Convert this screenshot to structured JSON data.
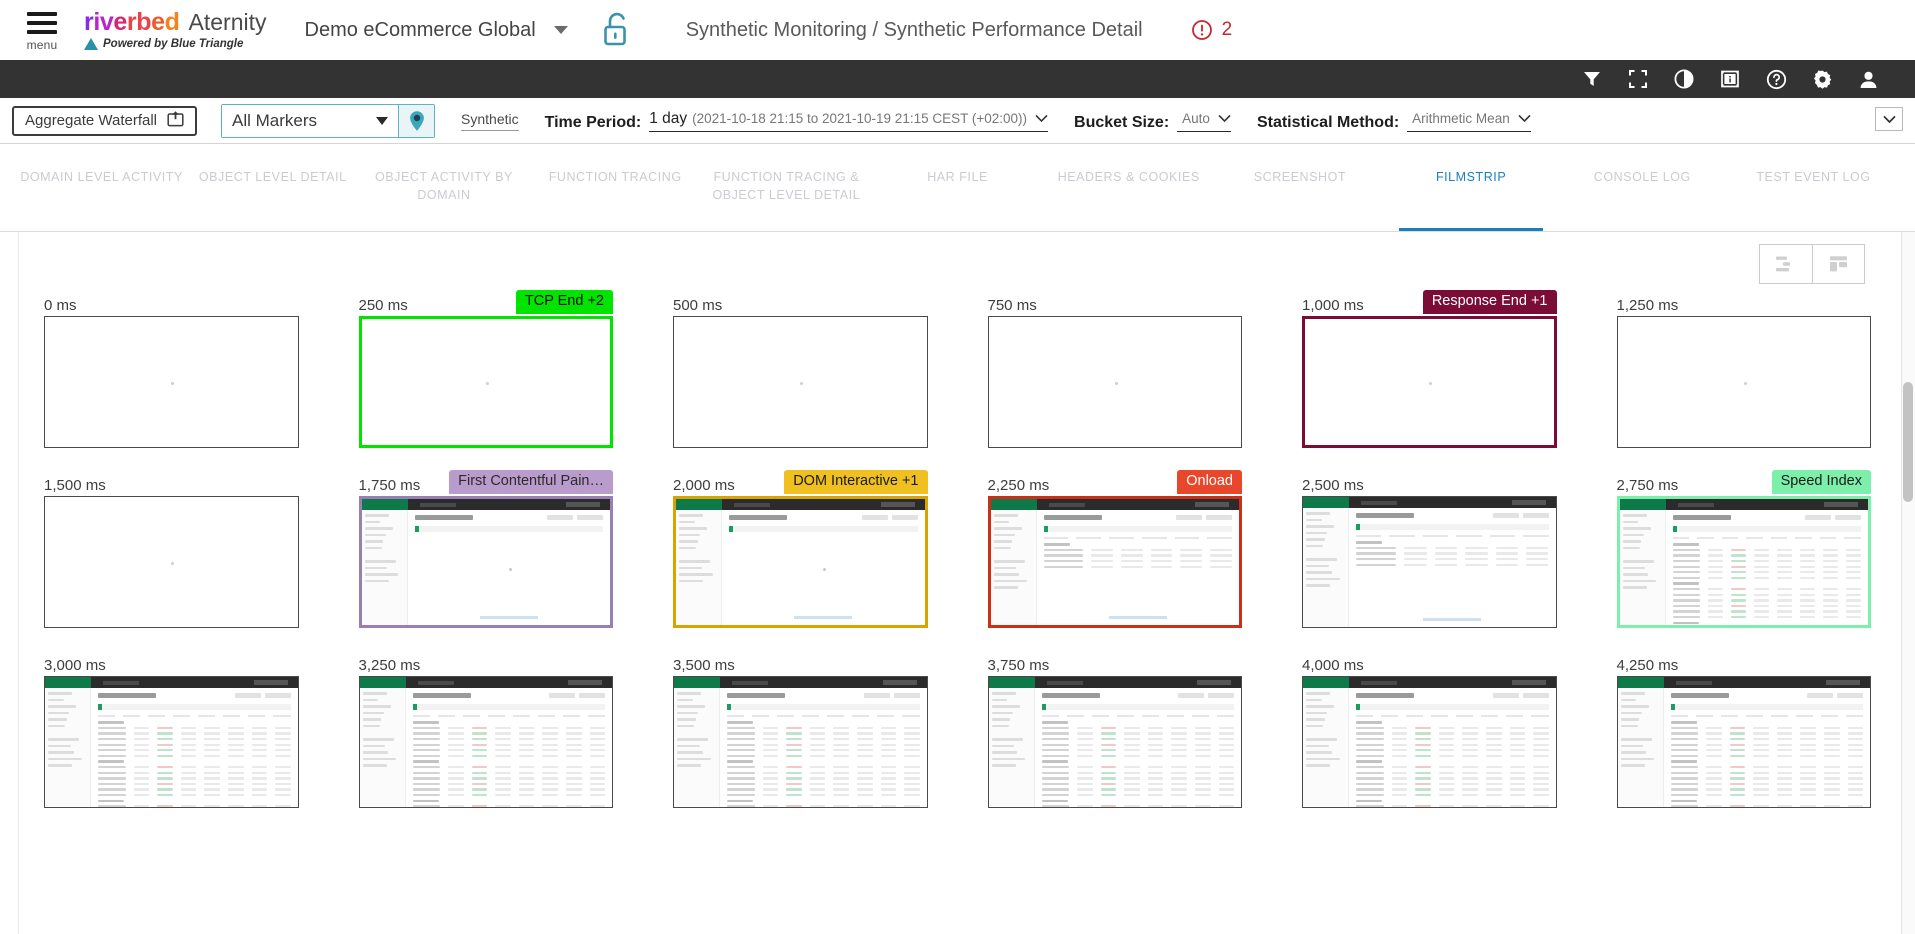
{
  "header": {
    "menu_label": "menu",
    "brand_letters": [
      "r",
      "i",
      "v",
      "e",
      "r",
      "b",
      "e",
      "d"
    ],
    "brand_product": "Aternity",
    "powered_by": "Powered by Blue Triangle",
    "tenant": "Demo eCommerce Global",
    "page_title": "Synthetic Monitoring / Synthetic Performance Detail",
    "alert_count": "2",
    "icons": [
      "filter-icon",
      "fullscreen-icon",
      "contrast-icon",
      "film-info-icon",
      "help-icon",
      "settings-icon",
      "user-icon"
    ]
  },
  "filter_bar": {
    "aggregate_button": "Aggregate Waterfall",
    "markers_value": "All Markers",
    "markers_options": [
      "All Markers"
    ],
    "pin_icon": "map-pin-icon",
    "synthetic_chip": "Synthetic",
    "time_period_label": "Time Period:",
    "time_period_value": "1 day",
    "time_period_range": "(2021-10-18 21:15 to 2021-10-19 21:15 CEST (+02:00))",
    "bucket_size_label": "Bucket Size:",
    "bucket_size_value": "Auto",
    "statistical_method_label": "Statistical Method:",
    "statistical_method_value": "Arithmetic Mean"
  },
  "tabs": [
    {
      "label": "DOMAIN LEVEL ACTIVITY",
      "active": false
    },
    {
      "label": "OBJECT LEVEL DETAIL",
      "active": false
    },
    {
      "label": "OBJECT ACTIVITY BY DOMAIN",
      "active": false
    },
    {
      "label": "FUNCTION TRACING",
      "active": false
    },
    {
      "label": "FUNCTION TRACING & OBJECT LEVEL DETAIL",
      "active": false
    },
    {
      "label": "HAR FILE",
      "active": false
    },
    {
      "label": "HEADERS & COOKIES",
      "active": false
    },
    {
      "label": "SCREENSHOT",
      "active": false
    },
    {
      "label": "FILMSTRIP",
      "active": true
    },
    {
      "label": "CONSOLE LOG",
      "active": false
    },
    {
      "label": "TEST EVENT LOG",
      "active": false
    }
  ],
  "view_toggle": [
    {
      "name": "waterfall-view-icon",
      "selected": false
    },
    {
      "name": "tile-view-icon",
      "selected": false
    }
  ],
  "colors": {
    "accent_blue": "#1a7fbd",
    "teal": "#5ab4c4",
    "alert_red": "#c8262e",
    "tcp_end_green": "#00e400",
    "response_end_maroon": "#7a0c36",
    "fcp_purple": "#b99ccc",
    "dom_interactive_gold": "#f0c020",
    "onload_orange": "#e8472b",
    "speed_index_green": "#7cf0ab"
  },
  "filmstrip": {
    "frames": [
      {
        "time": "0 ms",
        "marker": null,
        "blank": true
      },
      {
        "time": "250 ms",
        "marker": "TCP End +2",
        "blank": true,
        "badge_bg": "#00e400",
        "badge_fg": "#0a0a0a",
        "border": "#00e400"
      },
      {
        "time": "500 ms",
        "marker": null,
        "blank": true
      },
      {
        "time": "750 ms",
        "marker": null,
        "blank": true
      },
      {
        "time": "1,000 ms",
        "marker": "Response End +1",
        "blank": true,
        "badge_bg": "#7a0c36",
        "badge_fg": "#ffffff",
        "border": "#7a0c36"
      },
      {
        "time": "1,250 ms",
        "marker": null,
        "blank": true
      },
      {
        "time": "1,500 ms",
        "marker": null,
        "blank": true
      },
      {
        "time": "1,750 ms",
        "marker": "First Contentful Pain…",
        "blank": false,
        "badge_bg": "#b99ccc",
        "badge_fg": "#2b2b2b",
        "border": "#9a7fb5",
        "mock": "loading"
      },
      {
        "time": "2,000 ms",
        "marker": "DOM Interactive +1",
        "blank": false,
        "badge_bg": "#f0c020",
        "badge_fg": "#1a1a1a",
        "border": "#d9a400",
        "mock": "loading"
      },
      {
        "time": "2,250 ms",
        "marker": "Onload",
        "blank": false,
        "badge_bg": "#e8472b",
        "badge_fg": "#ffffff",
        "border": "#cc2e16",
        "mock": "partial"
      },
      {
        "time": "2,500 ms",
        "marker": null,
        "blank": false,
        "mock": "partial"
      },
      {
        "time": "2,750 ms",
        "marker": "Speed Index",
        "blank": false,
        "badge_bg": "#7cf0ab",
        "badge_fg": "#1a1a1a",
        "border": "#7cf0ab",
        "mock": "full"
      },
      {
        "time": "3,000 ms",
        "marker": null,
        "blank": false,
        "mock": "full"
      },
      {
        "time": "3,250 ms",
        "marker": null,
        "blank": false,
        "mock": "full"
      },
      {
        "time": "3,500 ms",
        "marker": null,
        "blank": false,
        "mock": "full"
      },
      {
        "time": "3,750 ms",
        "marker": null,
        "blank": false,
        "mock": "full"
      },
      {
        "time": "4,000 ms",
        "marker": null,
        "blank": false,
        "mock": "full"
      },
      {
        "time": "4,250 ms",
        "marker": null,
        "blank": false,
        "mock": "full"
      }
    ]
  }
}
